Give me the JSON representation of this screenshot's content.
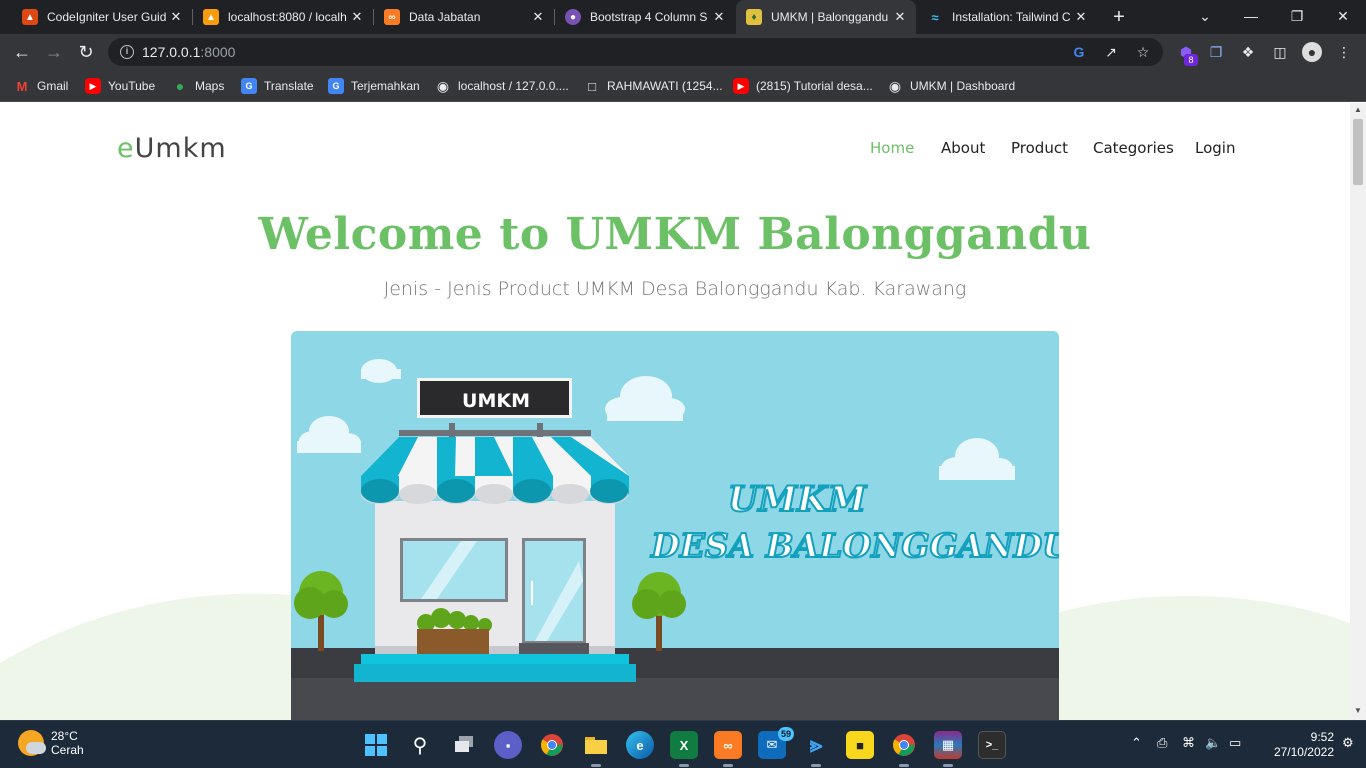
{
  "browser": {
    "tabs": [
      {
        "title": "CodeIgniter User Guid",
        "icon": "codeigniter-icon",
        "color": "#dd4814",
        "active": false
      },
      {
        "title": "localhost:8080 / localh",
        "icon": "phpmyadmin-icon",
        "color": "#f89c0e",
        "active": false
      },
      {
        "title": "Data Jabatan",
        "icon": "xampp-icon",
        "color": "#fb7a24",
        "active": false
      },
      {
        "title": "Bootstrap 4 Column S",
        "icon": "bootstrap-icon",
        "color": "#7952b3",
        "active": false
      },
      {
        "title": "UMKM | Balonggandu",
        "icon": "umkm-logo-icon",
        "color": "#e0c040",
        "active": true
      },
      {
        "title": "Installation: Tailwind C",
        "icon": "tailwind-icon",
        "color": "#38bdf8",
        "active": false
      }
    ],
    "url_host": "127.0.0.1",
    "url_port": ":8000",
    "extension_badge": "8",
    "bookmarks": [
      {
        "label": "Gmail",
        "icon": "gmail-icon",
        "color": "#ea4335"
      },
      {
        "label": "YouTube",
        "icon": "youtube-icon",
        "color": "#ff0000"
      },
      {
        "label": "Maps",
        "icon": "maps-icon",
        "color": "#34a853"
      },
      {
        "label": "Translate",
        "icon": "translate-icon",
        "color": "#4285f4"
      },
      {
        "label": "Terjemahkan",
        "icon": "translate-icon",
        "color": "#4285f4"
      },
      {
        "label": "localhost / 127.0.0....",
        "icon": "globe-icon",
        "color": "#e8eaed"
      },
      {
        "label": "RAHMAWATI (1254...",
        "icon": "document-icon",
        "color": "#e8eaed"
      },
      {
        "label": "(2815) Tutorial desa...",
        "icon": "youtube-icon",
        "color": "#ff0000"
      },
      {
        "label": "UMKM | Dashboard",
        "icon": "globe-icon",
        "color": "#e8eaed"
      }
    ]
  },
  "site": {
    "brand_prefix": "e",
    "brand_rest": "Umkm",
    "nav": [
      {
        "label": "Home",
        "active": true
      },
      {
        "label": "About",
        "active": false
      },
      {
        "label": "Product",
        "active": false
      },
      {
        "label": "Categories",
        "active": false
      },
      {
        "label": "Login",
        "active": false
      }
    ],
    "hero_title": "Welcome to UMKM Balonggandu",
    "hero_subtitle": "Jenis - Jenis Product UMKM Desa Balonggandu Kab. Karawang",
    "banner": {
      "sign_text": "UMKM",
      "headline_line1": "UMKM",
      "headline_line2": "DESA BALONGGANDU"
    },
    "colors": {
      "accent": "#6cc066",
      "banner_sky": "#8dd7e6",
      "awning": "#12b4cf"
    }
  },
  "taskbar": {
    "temperature": "28°C",
    "weather": "Cerah",
    "time": "9:52",
    "date": "27/10/2022",
    "mail_badge": "59"
  }
}
